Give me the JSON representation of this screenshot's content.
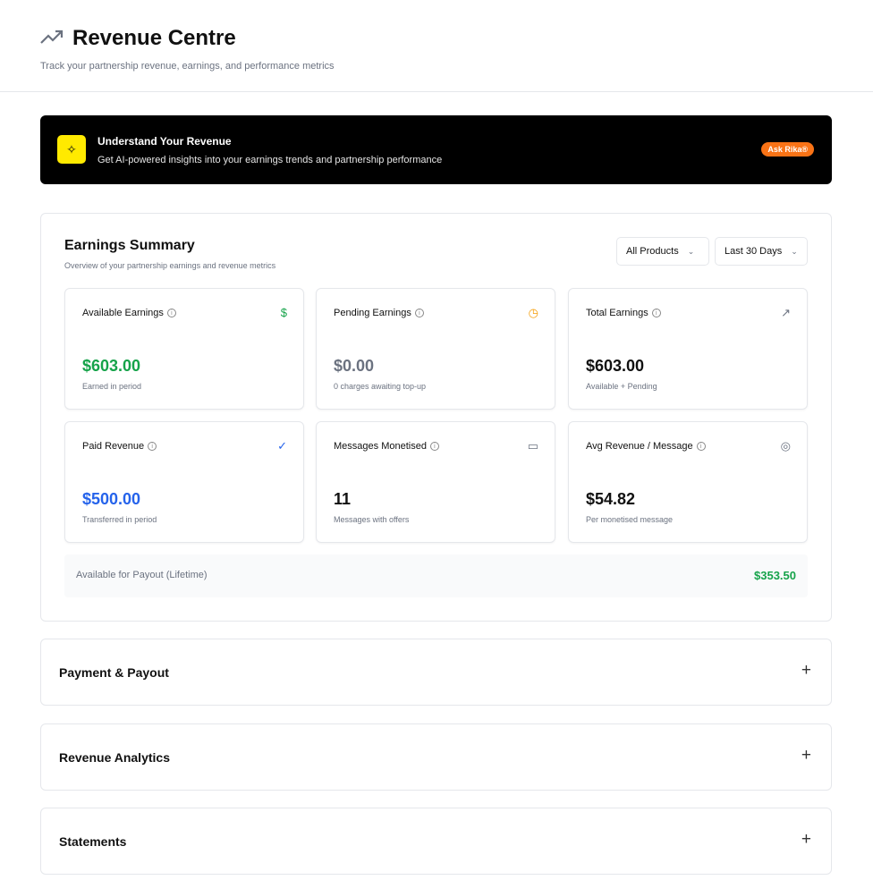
{
  "header": {
    "title": "Revenue Centre",
    "subtitle": "Track your partnership revenue, earnings, and performance metrics"
  },
  "banner": {
    "title": "Understand Your Revenue",
    "subtitle": "Get AI-powered insights into your earnings trends and partnership performance",
    "button": "Ask Rika®"
  },
  "summary": {
    "title": "Earnings Summary",
    "subtitle": "Overview of your partnership earnings and revenue metrics",
    "product_filter": "All Products",
    "period_filter": "Last 30 Days",
    "cards": [
      {
        "label": "Available Earnings",
        "value": "$603.00",
        "note": "Earned in period",
        "icon": "dollar-icon",
        "color": "#16a34a"
      },
      {
        "label": "Pending Earnings",
        "value": "$0.00",
        "note": "0 charges awaiting top-up",
        "icon": "clock-icon",
        "color": "#6b7280"
      },
      {
        "label": "Total Earnings",
        "value": "$603.00",
        "note": "Available + Pending",
        "icon": "trending-up-icon",
        "color": "#111111"
      },
      {
        "label": "Paid Revenue",
        "value": "$500.00",
        "note": "Transferred in period",
        "icon": "check-circle-icon",
        "color": "#2563eb"
      },
      {
        "label": "Messages Monetised",
        "value": "11",
        "note": "Messages with offers",
        "icon": "message-icon",
        "color": "#111111"
      },
      {
        "label": "Avg Revenue / Message",
        "value": "$54.82",
        "note": "Per monetised message",
        "icon": "target-icon",
        "color": "#111111"
      }
    ],
    "payout": {
      "label": "Available for Payout (Lifetime)",
      "value": "$353.50"
    }
  },
  "sections": [
    {
      "title": "Payment & Payout"
    },
    {
      "title": "Revenue Analytics"
    },
    {
      "title": "Statements"
    }
  ]
}
